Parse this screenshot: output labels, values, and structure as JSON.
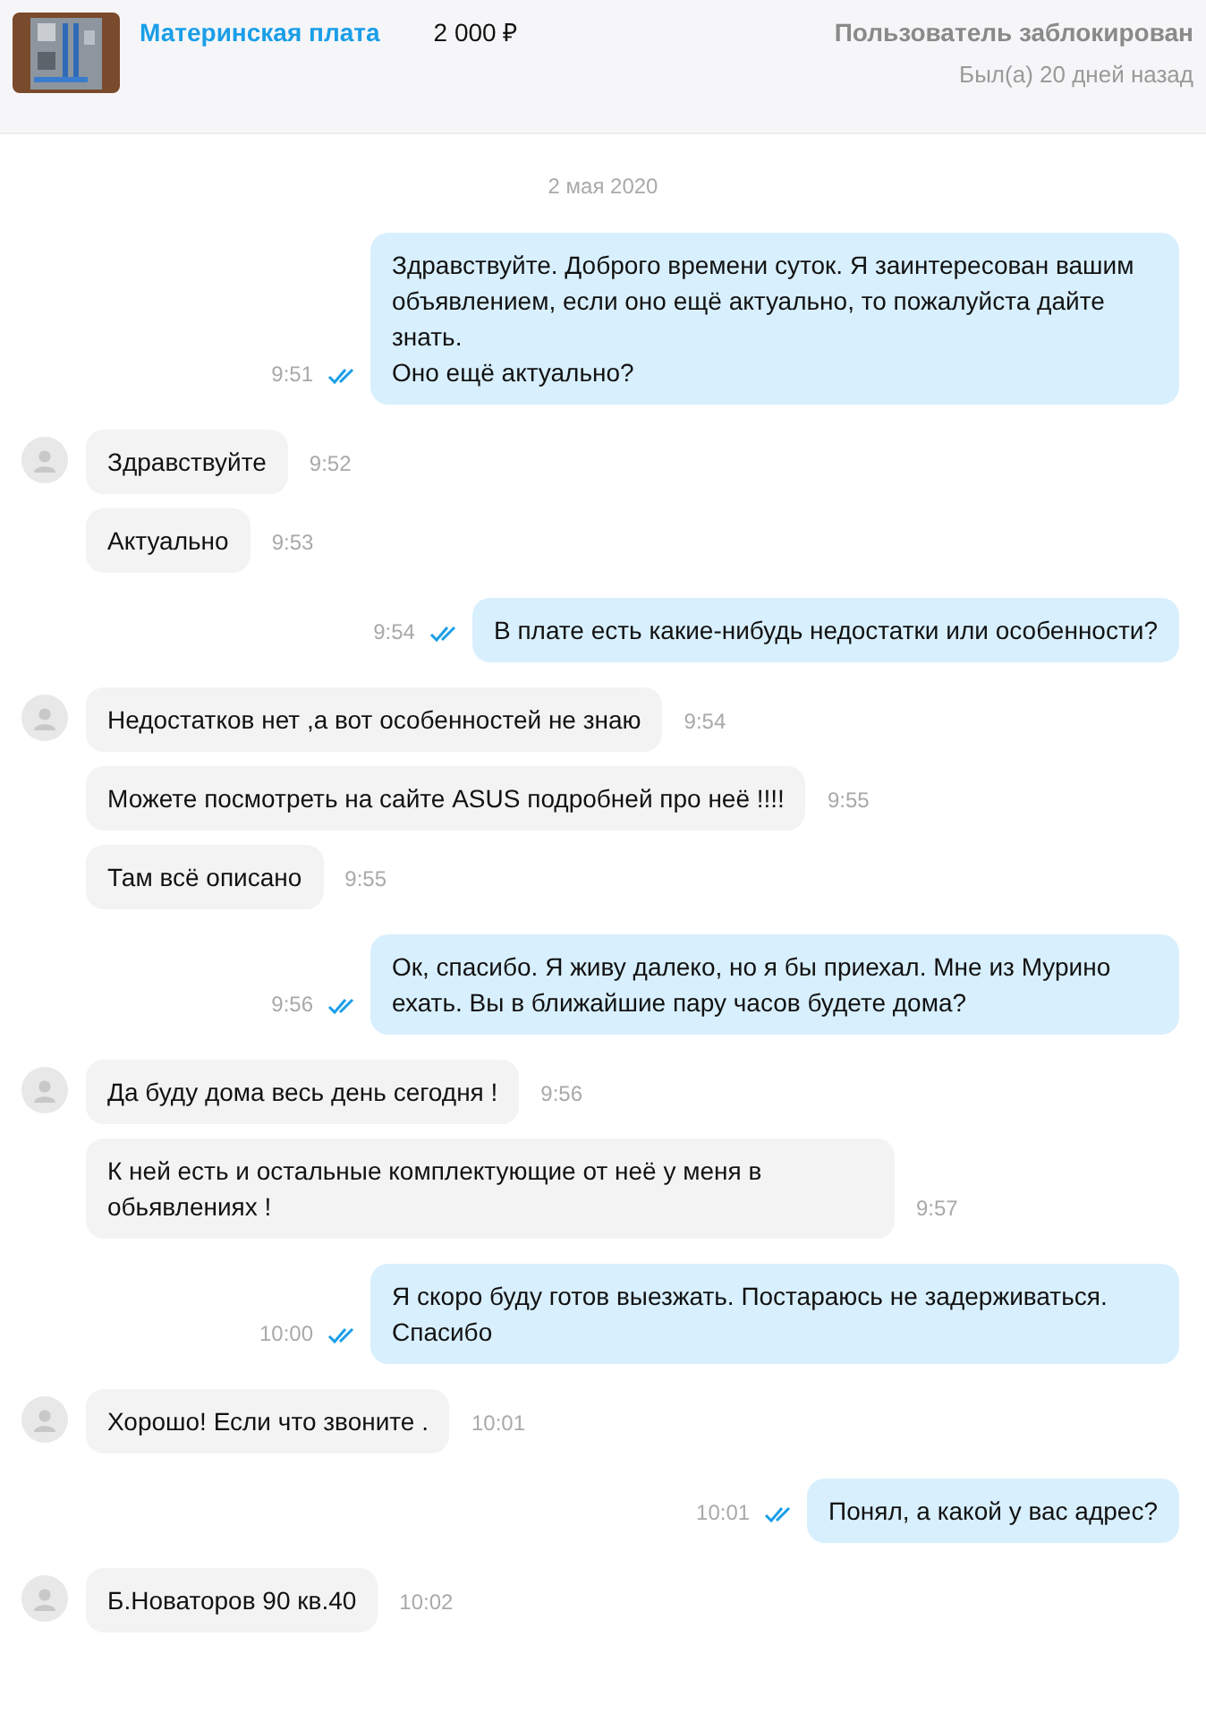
{
  "header": {
    "title": "Материнская плата",
    "price": "2 000 ₽",
    "user_status": "Пользователь заблокирован",
    "last_seen": "Был(а) 20 дней назад"
  },
  "date": "2 мая 2020",
  "groups": [
    {
      "kind": "outgoing",
      "messages": [
        {
          "text": "Здравствуйте. Доброго времени суток. Я заинтересован вашим объявлением, если оно ещё актуально, то пожалуйста дайте знать.\nОно ещё актуально?",
          "time": "9:51",
          "read": true
        }
      ]
    },
    {
      "kind": "incoming",
      "messages": [
        {
          "text": "Здравствуйте",
          "time": "9:52"
        },
        {
          "text": "Актуально",
          "time": "9:53"
        }
      ]
    },
    {
      "kind": "outgoing",
      "messages": [
        {
          "text": "В плате есть какие-нибудь недостатки или особенности?",
          "time": "9:54",
          "read": true
        }
      ]
    },
    {
      "kind": "incoming",
      "messages": [
        {
          "text": "Недостатков нет ,а вот особенностей не знаю",
          "time": "9:54"
        },
        {
          "text": "Можете посмотреть на сайте ASUS подробней про неё !!!!",
          "time": "9:55"
        },
        {
          "text": "Там всё описано",
          "time": "9:55"
        }
      ]
    },
    {
      "kind": "outgoing",
      "messages": [
        {
          "text": "Ок, спасибо. Я живу далеко, но я бы приехал. Мне из Мурино ехать. Вы в ближайшие пару часов будете дома?",
          "time": "9:56",
          "read": true
        }
      ]
    },
    {
      "kind": "incoming",
      "messages": [
        {
          "text": "Да буду дома весь день сегодня !",
          "time": "9:56"
        },
        {
          "text": "К ней есть и остальные комплектующие от неё у меня в обьявлениях !",
          "time": "9:57"
        }
      ]
    },
    {
      "kind": "outgoing",
      "messages": [
        {
          "text": "Я скоро буду готов выезжать. Постараюсь не задерживаться. Спасибо",
          "time": "10:00",
          "read": true
        }
      ]
    },
    {
      "kind": "incoming",
      "messages": [
        {
          "text": "Хорошо! Если что звоните .",
          "time": "10:01"
        }
      ]
    },
    {
      "kind": "outgoing",
      "messages": [
        {
          "text": "Понял, а какой у вас адрес?",
          "time": "10:01",
          "read": true
        }
      ]
    },
    {
      "kind": "incoming",
      "messages": [
        {
          "text": "Б.Новаторов 90 кв.40",
          "time": "10:02"
        }
      ]
    }
  ]
}
